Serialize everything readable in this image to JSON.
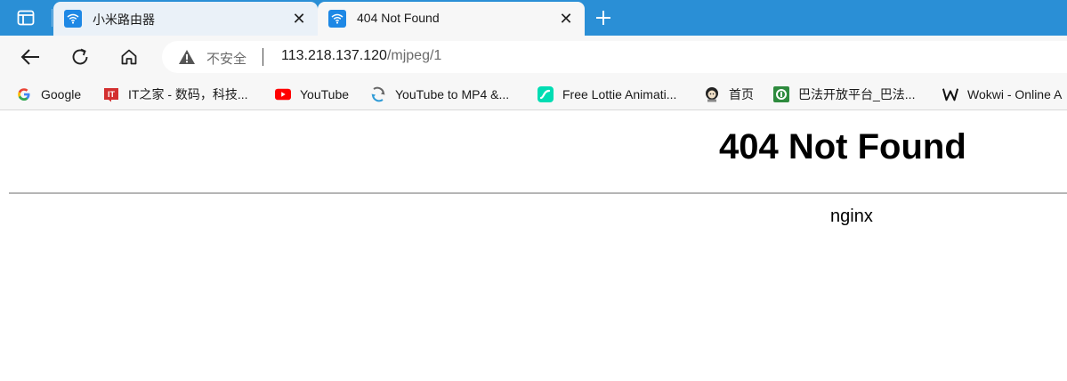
{
  "tabs": [
    {
      "title": "小米路由器",
      "active": false,
      "icon": "wifi-icon"
    },
    {
      "title": "404 Not Found",
      "active": true,
      "icon": "wifi-icon"
    }
  ],
  "address_bar": {
    "security_label": "不安全",
    "url_host": "113.218.137.120",
    "url_path": "/mjpeg/1"
  },
  "bookmarks": [
    {
      "label": "Google",
      "icon": "google-icon"
    },
    {
      "label": "IT之家 - 数码，科技...",
      "icon": "ithome-icon"
    },
    {
      "label": "YouTube",
      "icon": "youtube-icon"
    },
    {
      "label": "YouTube to MP4 &...",
      "icon": "converter-icon"
    },
    {
      "label": "Free Lottie Animati...",
      "icon": "lottie-icon"
    },
    {
      "label": "首页",
      "icon": "avatar-icon"
    },
    {
      "label": "巴法开放平台_巴法...",
      "icon": "bafa-icon"
    },
    {
      "label": "Wokwi - Online A",
      "icon": "wokwi-icon"
    }
  ],
  "page": {
    "heading": "404 Not Found",
    "server": "nginx"
  },
  "colors": {
    "tabstrip": "#2a8fd6",
    "accent": "#1e88e5"
  }
}
